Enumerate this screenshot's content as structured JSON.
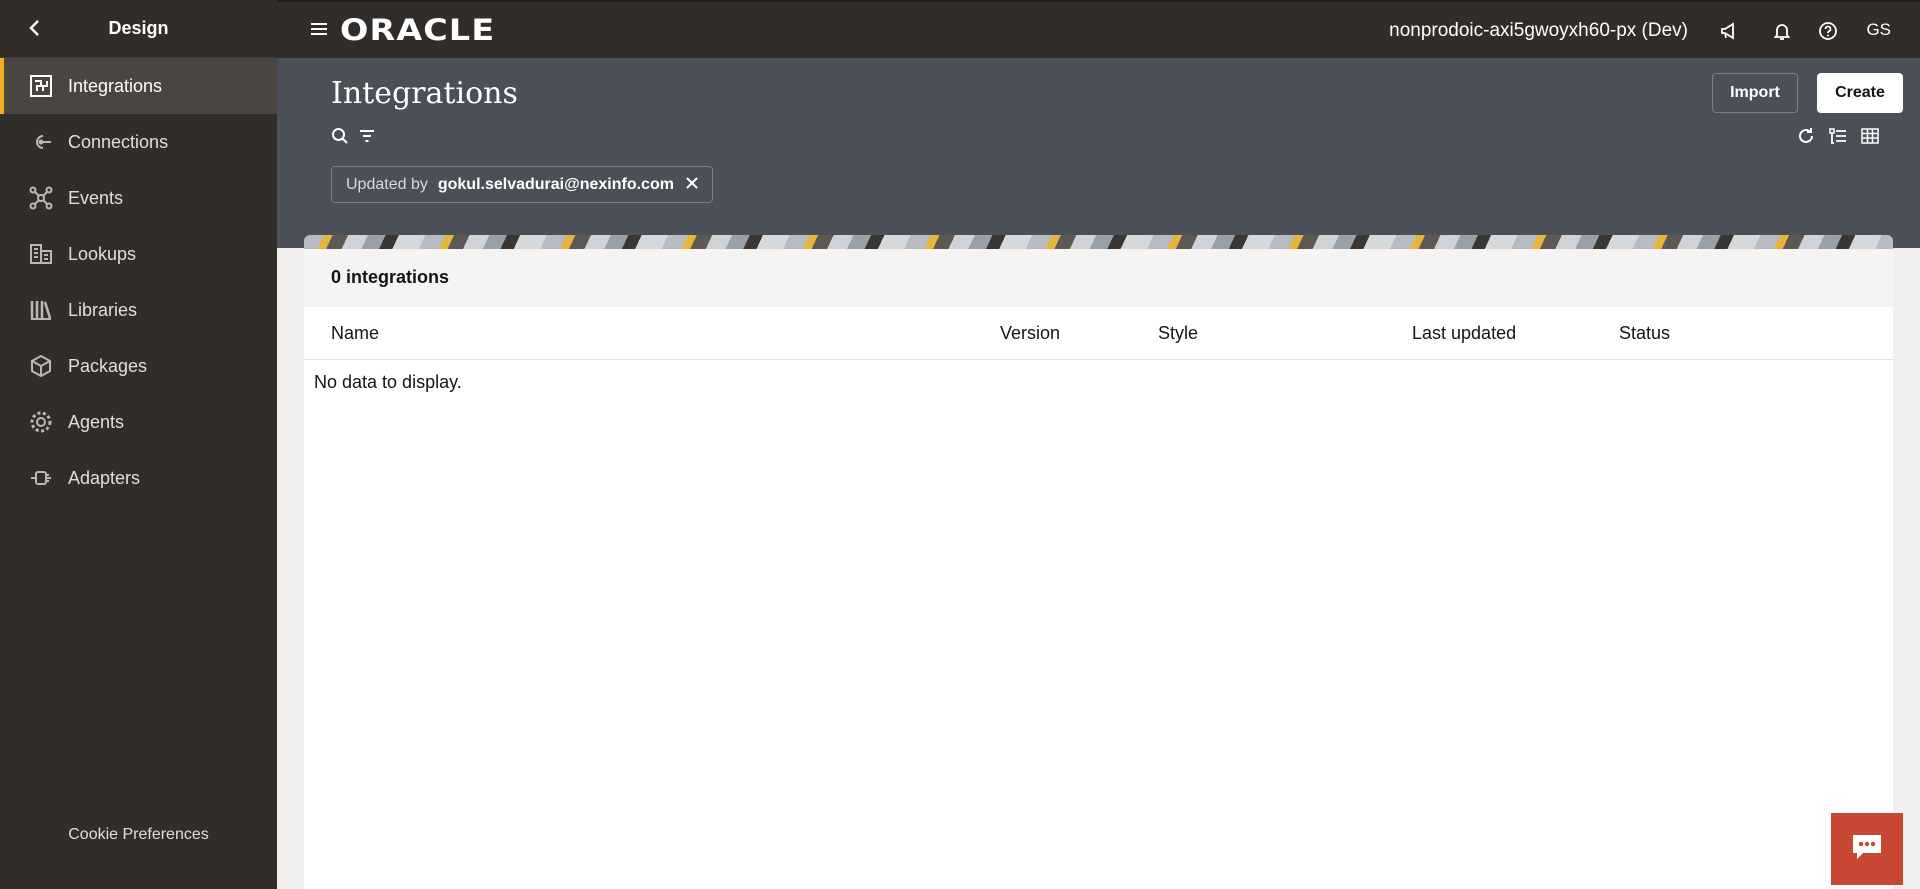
{
  "topbar": {
    "logo": "ORACLE",
    "environment": "nonprodoic-axi5gwoyxh60-px (Dev)",
    "user_initials": "GS",
    "icons": [
      "menu-icon",
      "megaphone-icon",
      "bell-icon",
      "help-icon"
    ]
  },
  "sidebar": {
    "title": "Design",
    "items": [
      {
        "label": "Integrations",
        "icon": "integrations-icon",
        "active": true
      },
      {
        "label": "Connections",
        "icon": "connections-icon"
      },
      {
        "label": "Events",
        "icon": "events-icon"
      },
      {
        "label": "Lookups",
        "icon": "lookups-icon"
      },
      {
        "label": "Libraries",
        "icon": "libraries-icon"
      },
      {
        "label": "Packages",
        "icon": "packages-icon"
      },
      {
        "label": "Agents",
        "icon": "agents-icon"
      },
      {
        "label": "Adapters",
        "icon": "adapters-icon"
      }
    ],
    "footer": "Cookie Preferences"
  },
  "header": {
    "title": "Integrations",
    "import_label": "Import",
    "create_label": "Create"
  },
  "filter": {
    "label": "Updated by",
    "value": "gokul.selvadurai@nexinfo.com"
  },
  "results": {
    "count_label": "0 integrations",
    "columns": [
      "Name",
      "Version",
      "Style",
      "Last updated",
      "Status"
    ],
    "empty_message": "No data to display."
  },
  "colors": {
    "topbar": "#312d2a",
    "header": "#4a4f58",
    "accent": "#f2b01e",
    "chat": "#c74634"
  }
}
